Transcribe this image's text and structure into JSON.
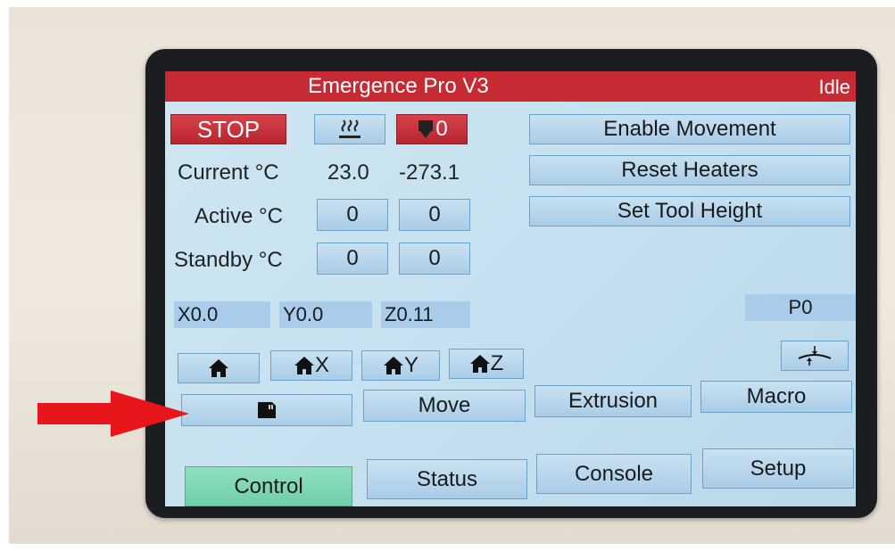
{
  "header": {
    "title": "Emergence Pro V3",
    "status": "Idle"
  },
  "top": {
    "stop_label": "STOP",
    "tool_count": "0"
  },
  "temps": {
    "current_label": "Current °C",
    "current_bed": "23.0",
    "current_tool": "-273.1",
    "active_label": "Active °C",
    "active_bed": "0",
    "active_tool": "0",
    "standby_label": "Standby °C",
    "standby_bed": "0",
    "standby_tool": "0"
  },
  "actions": {
    "enable_movement": "Enable Movement",
    "reset_heaters": "Reset Heaters",
    "set_tool_height": "Set Tool Height"
  },
  "coords": {
    "x": "X0.0",
    "y": "Y0.0",
    "z": "Z0.11",
    "p": "P0"
  },
  "home": {
    "x": "X",
    "y": "Y",
    "z": "Z"
  },
  "menu": {
    "move": "Move",
    "extrusion": "Extrusion",
    "macro": "Macro"
  },
  "tabs": {
    "control": "Control",
    "status": "Status",
    "console": "Console",
    "setup": "Setup"
  },
  "colors": {
    "title_bar": "#c62b34",
    "stop": "#c62b34",
    "active_tab": "#7fd8b4",
    "screen": "#c6e1ef",
    "arrow": "#e8161a"
  }
}
